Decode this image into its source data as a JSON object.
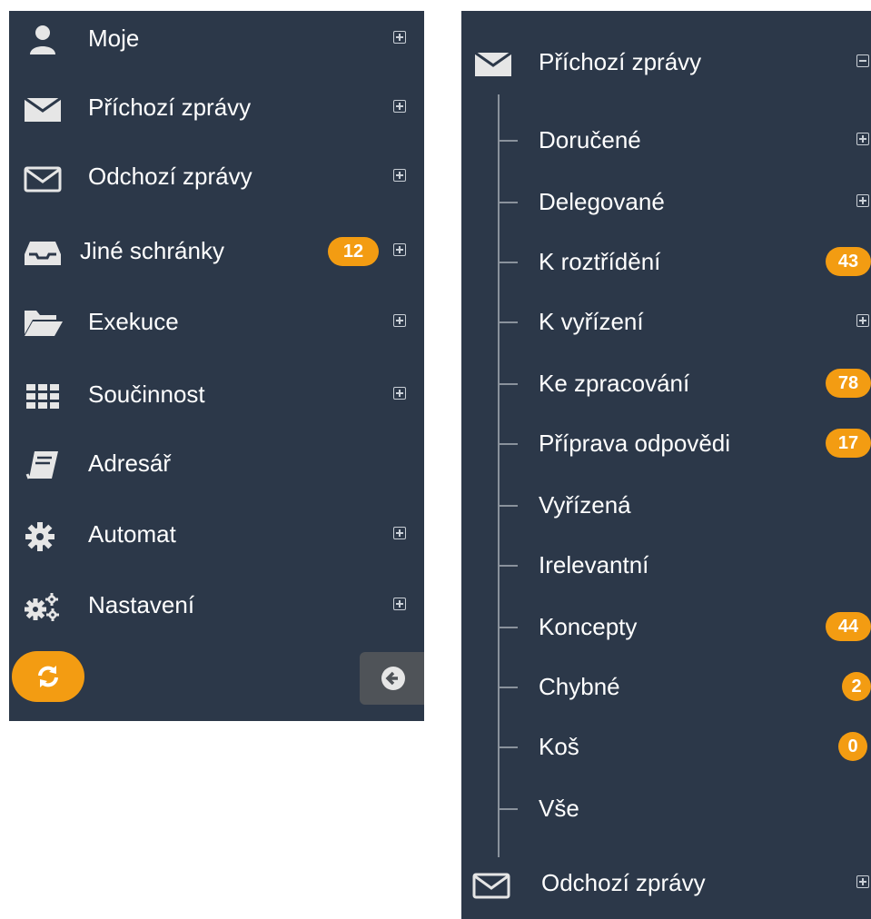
{
  "left_panel": {
    "items": [
      {
        "label": "Moje",
        "icon": "user-icon",
        "expandable": true
      },
      {
        "label": "Příchozí zprávy",
        "icon": "envelope-filled-icon",
        "expandable": true
      },
      {
        "label": "Odchozí zprávy",
        "icon": "envelope-outline-icon",
        "expandable": true
      },
      {
        "label": "Jiné schránky",
        "icon": "inbox-tray-icon",
        "expandable": true,
        "badge": "12"
      },
      {
        "label": "Exekuce",
        "icon": "folder-open-icon",
        "expandable": true
      },
      {
        "label": "Součinnost",
        "icon": "grid-icon",
        "expandable": true
      },
      {
        "label": "Adresář",
        "icon": "book-icon",
        "expandable": false
      },
      {
        "label": "Automat",
        "icon": "cog-icon",
        "expandable": true
      },
      {
        "label": "Nastavení",
        "icon": "cogs-icon",
        "expandable": true
      }
    ],
    "refresh_icon": "refresh-icon",
    "collapse_icon": "arrow-left-circle-icon"
  },
  "right_panel": {
    "header": {
      "label": "Příchozí zprávy",
      "icon": "envelope-filled-icon",
      "expanded": true
    },
    "subitems": [
      {
        "label": "Doručené",
        "expandable": true
      },
      {
        "label": "Delegované",
        "expandable": true
      },
      {
        "label": "K roztřídění",
        "badge": "43"
      },
      {
        "label": "K vyřízení",
        "expandable": true
      },
      {
        "label": "Ke zpracování",
        "badge": "78"
      },
      {
        "label": "Příprava odpovědi",
        "badge": "17"
      },
      {
        "label": "Vyřízená"
      },
      {
        "label": "Irelevantní"
      },
      {
        "label": "Koncepty",
        "badge": "44"
      },
      {
        "label": "Chybné",
        "badge": "2"
      },
      {
        "label": "Koš",
        "badge": "0"
      },
      {
        "label": "Vše"
      }
    ],
    "footer": {
      "label": "Odchozí zprávy",
      "icon": "envelope-outline-icon",
      "expandable": true
    }
  },
  "colors": {
    "panel_bg": "#2c3849",
    "badge": "#f39c12",
    "text": "#ffffff"
  }
}
